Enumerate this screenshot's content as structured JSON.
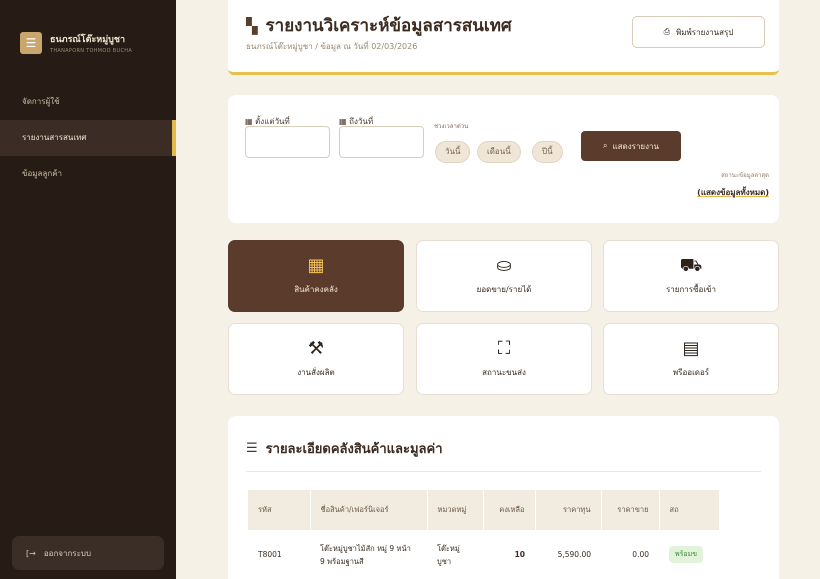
{
  "sidebar": {
    "brand_title": "ธนภรณ์โต๊ะหมู่บูชา",
    "brand_subtitle": "THANAPORN TOHMOO BUCHA",
    "items": [
      {
        "label": "จัดการผู้ใช้",
        "active": false
      },
      {
        "label": "รายงานสารสนเทศ",
        "active": true
      },
      {
        "label": "ข้อมูลลูกค้า",
        "active": false
      }
    ],
    "logout_label": "ออกจากระบบ"
  },
  "header": {
    "title": "รายงานวิเคราะห์ข้อมูลสารสนเทศ",
    "subtitle": "ธนภรณ์โต๊ะหมู่บูชา / ข้อมูล ณ วันที่ 02/03/2026",
    "summary_button": "พิมพ์รายงานสรุป"
  },
  "filter": {
    "start_label": "ตั้งแต่วันที่",
    "end_label": "ถึงวันที่",
    "start_value": "",
    "end_value": "",
    "range_label": "ช่วงเวลาด่วน",
    "quick_ranges": [
      "วันนี้",
      "เดือนนี้",
      "ปีนี้"
    ],
    "show_button": "แสดงรายงาน",
    "latest_label": "สถานะข้อมูลล่าสุด",
    "latest_link": "(แสดงข้อมูลทั้งหมด)"
  },
  "tiles": [
    {
      "label": "สินค้าคงคลัง",
      "icon": "boxes-icon",
      "active": true
    },
    {
      "label": "ยอดขาย/รายได้",
      "icon": "hand-coin-icon",
      "active": false
    },
    {
      "label": "รายการซื้อเข้า",
      "icon": "cart-icon",
      "active": false
    },
    {
      "label": "งานสั่งผลิต",
      "icon": "hammer-icon",
      "active": false
    },
    {
      "label": "สถานะขนส่ง",
      "icon": "delivery-icon",
      "active": false
    },
    {
      "label": "พรีออเดอร์",
      "icon": "clipboard-icon",
      "active": false
    }
  ],
  "table": {
    "title": "รายละเอียดคลังสินค้าและมูลค่า",
    "columns": [
      "รหัส",
      "ชื่อสินค้า/เฟอร์นิเจอร์",
      "หมวดหมู่",
      "คงเหลือ",
      "ราคาทุน",
      "ราคาขาย",
      "สถ"
    ],
    "rows": [
      {
        "id": "T8001",
        "name": "โต๊ะหมู่บูชาไม้สัก หมู่ 9 หน้า 9 พร้อมฐานสี",
        "category": "โต๊ะหมู่บูชา",
        "stock": "10",
        "cost": "5,590.00",
        "price": "0.00",
        "status": "พร้อมข"
      }
    ]
  },
  "colors": {
    "sidebar_bg": "#261b15",
    "accent_gold": "#e3b94c",
    "primary_brown": "#5a3b2c",
    "page_bg": "#f6f1e7"
  }
}
